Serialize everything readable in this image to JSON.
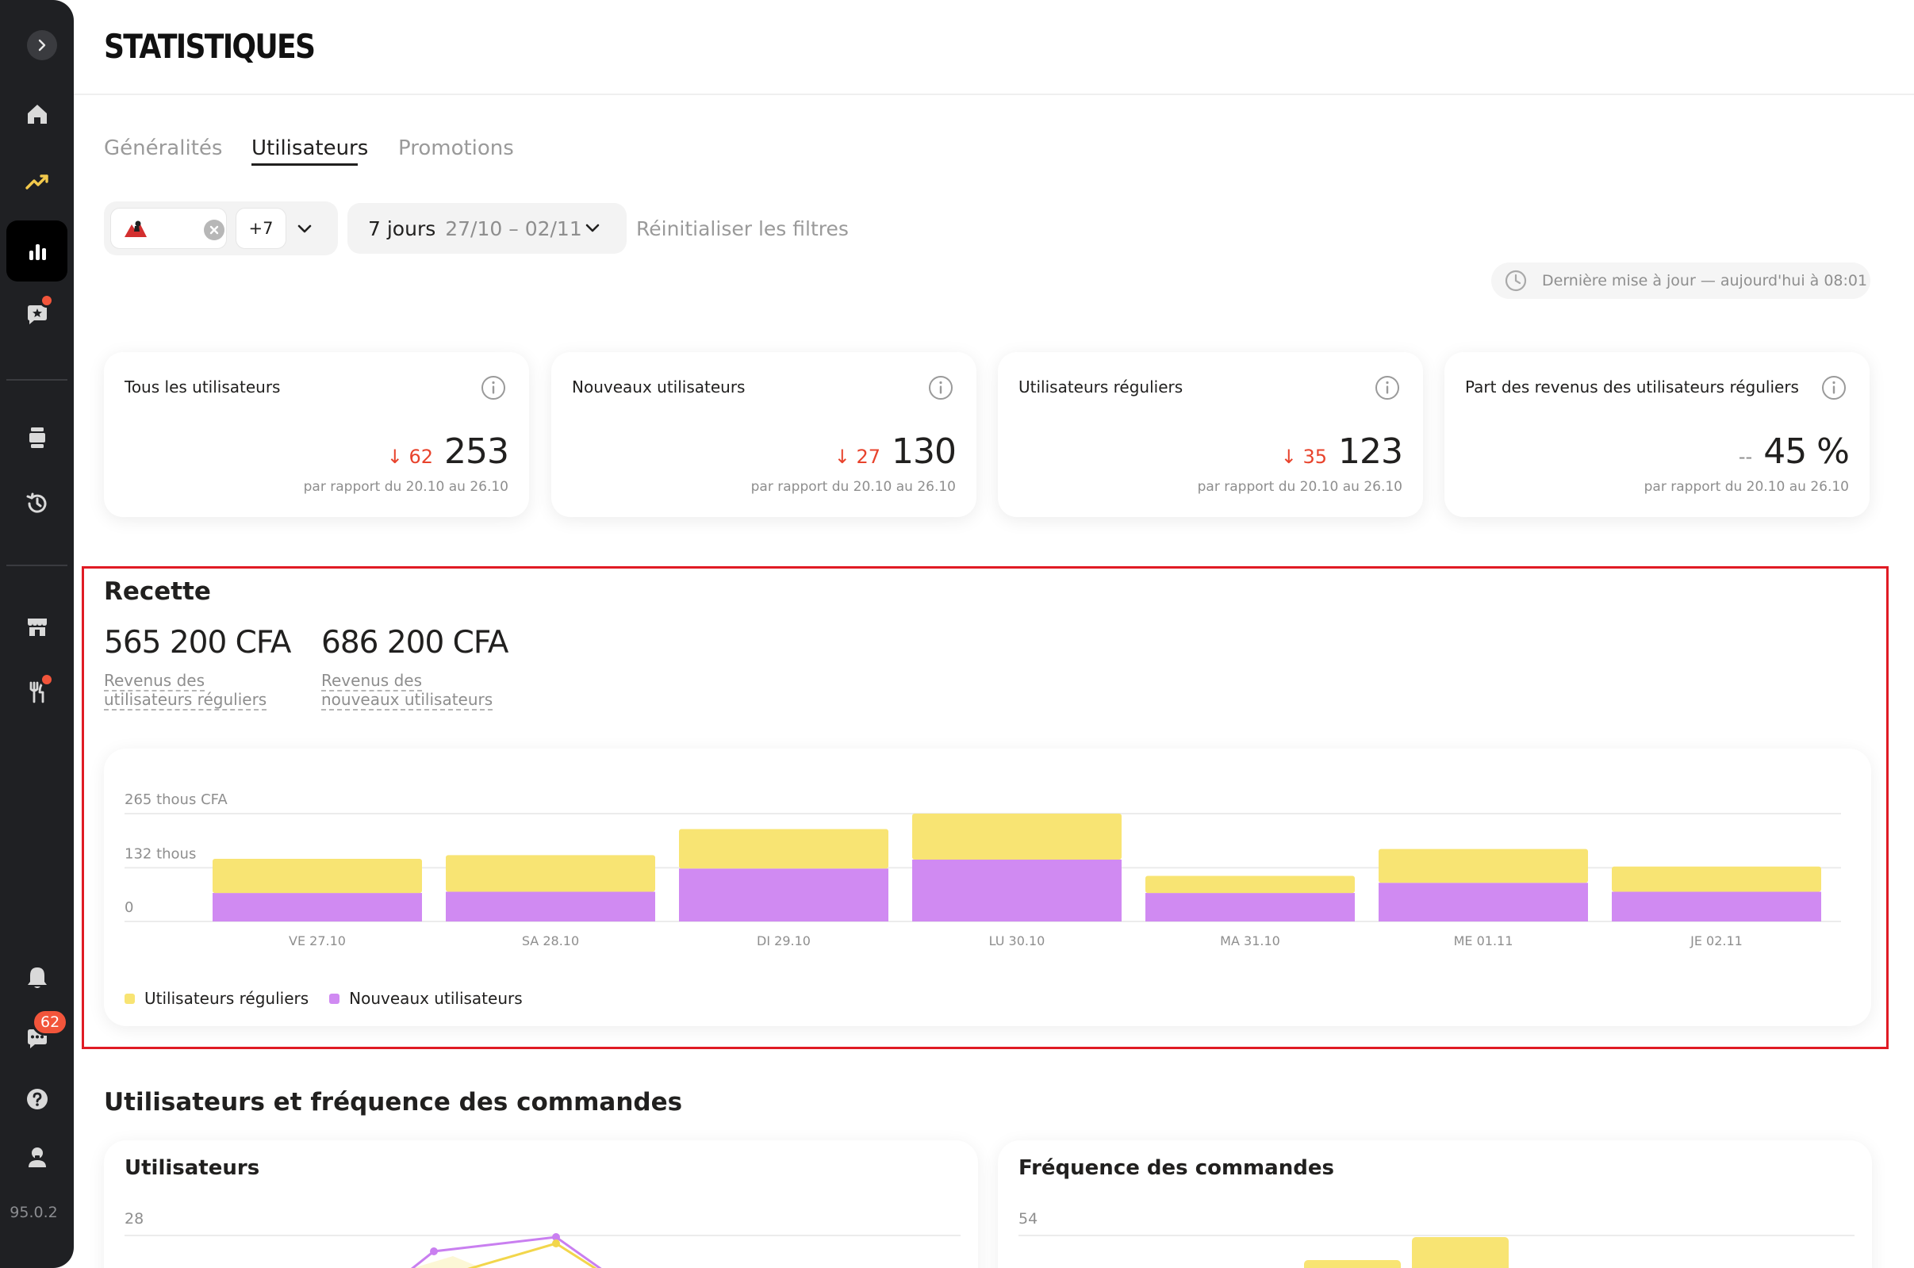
{
  "sidebar": {
    "version": "95.0.2",
    "chat_badge": "62",
    "icons": [
      "chevron-right-icon",
      "home-icon",
      "trending-icon",
      "bar-chart-icon",
      "feedback-icon",
      "device-icon",
      "history-icon",
      "store-icon",
      "restaurant-icon",
      "bell-icon",
      "chat-icon",
      "help-icon",
      "support-icon"
    ]
  },
  "header": {
    "title": "STATISTIQUES"
  },
  "tabs": [
    {
      "label": "Généralités",
      "active": false
    },
    {
      "label": "Utilisateurs",
      "active": true
    },
    {
      "label": "Promotions",
      "active": false
    }
  ],
  "filters": {
    "extra_count": "+7",
    "period_label": "7 jours",
    "period_range": "27/10 – 02/11",
    "reset_label": "Réinitialiser les filtres"
  },
  "last_update": "Dernière mise à jour — aujourd'hui à 08:01",
  "kpis": [
    {
      "title": "Tous les utilisateurs",
      "delta": "↓ 62",
      "value": "253",
      "comparison": "par rapport du 20.10 au 26.10"
    },
    {
      "title": "Nouveaux utilisateurs",
      "delta": "↓ 27",
      "value": "130",
      "comparison": "par rapport du 20.10 au 26.10"
    },
    {
      "title": "Utilisateurs réguliers",
      "delta": "↓ 35",
      "value": "123",
      "comparison": "par rapport du 20.10 au 26.10"
    },
    {
      "title": "Part des revenus des utilisateurs réguliers",
      "delta": "--",
      "value": "45 %",
      "comparison": "par rapport du 20.10 au 26.10"
    }
  ],
  "recette": {
    "title": "Recette",
    "regular_revenue": "565 200 CFA",
    "regular_label_1": "Revenus des",
    "regular_label_2": "utilisateurs réguliers",
    "new_revenue": "686 200 CFA",
    "new_label_1": "Revenus des",
    "new_label_2": "nouveaux utilisateurs"
  },
  "chart_data": {
    "type": "bar",
    "stacked": true,
    "categories": [
      "VE 27.10",
      "SA 28.10",
      "DI 29.10",
      "LU 30.10",
      "MA 31.10",
      "ME 01.11",
      "JE 02.11"
    ],
    "series": [
      {
        "name": "Nouveaux utilisateurs",
        "color": "#d08af2",
        "values": [
          70,
          73,
          130,
          152,
          70,
          95,
          73
        ]
      },
      {
        "name": "Utilisateurs réguliers",
        "color": "#f8e473",
        "values": [
          84,
          90,
          97,
          113,
          42,
          83,
          62
        ]
      }
    ],
    "y_ticks": [
      {
        "value": 0,
        "label": "0"
      },
      {
        "value": 132,
        "label": "132 thous"
      },
      {
        "value": 265,
        "label": "265 thous CFA"
      }
    ],
    "ylim": [
      0,
      265
    ],
    "grid": true,
    "legend": "bottom-left",
    "colors": {
      "regular": "#f8e473",
      "new": "#d08af2"
    }
  },
  "users_section": {
    "title": "Utilisateurs et fréquence des commandes",
    "users_card_title": "Utilisateurs",
    "users_max": "28",
    "frequency_card_title": "Fréquence des commandes",
    "frequency_max": "54"
  }
}
